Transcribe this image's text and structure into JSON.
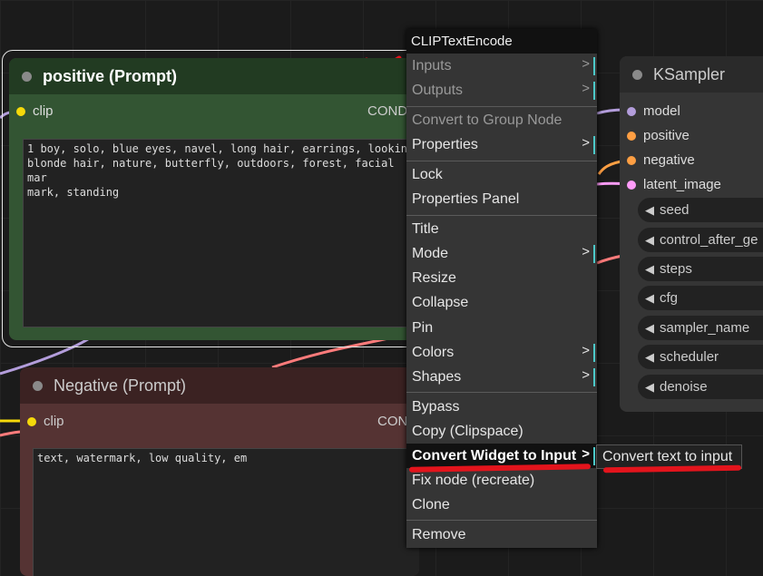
{
  "positive_node": {
    "title": "positive (Prompt)",
    "input_label": "clip",
    "output_label": "COND",
    "text": "1 boy, solo, blue eyes, navel, long hair, earrings, looking\nblonde hair, nature, butterfly, outdoors, forest, facial mar\nmark, standing"
  },
  "negative_node": {
    "title": "Negative (Prompt)",
    "input_label": "clip",
    "output_label": "CON",
    "text": "text, watermark, low quality, em"
  },
  "ksampler_node": {
    "title": "KSampler",
    "inputs": [
      "model",
      "positive",
      "negative",
      "latent_image"
    ],
    "widgets": [
      "seed",
      "control_after_ge",
      "steps",
      "cfg",
      "sampler_name",
      "scheduler",
      "denoise"
    ]
  },
  "context_menu": {
    "header": "CLIPTextEncode",
    "items": [
      {
        "label": "Inputs",
        "submenu": ">"
      },
      {
        "label": "Outputs",
        "submenu": ">"
      },
      {
        "label": "Convert to Group Node"
      },
      {
        "label": "Properties",
        "submenu": ">"
      },
      {
        "label": "Lock"
      },
      {
        "label": "Properties Panel"
      },
      {
        "label": "Title"
      },
      {
        "label": "Mode",
        "submenu": ">"
      },
      {
        "label": "Resize"
      },
      {
        "label": "Collapse"
      },
      {
        "label": "Pin"
      },
      {
        "label": "Colors",
        "submenu": ">"
      },
      {
        "label": "Shapes",
        "submenu": ">"
      },
      {
        "label": "Bypass"
      },
      {
        "label": "Copy (Clipspace)"
      },
      {
        "label": "Convert Widget to Input",
        "submenu": ">"
      },
      {
        "label": "Fix node (recreate)"
      },
      {
        "label": "Clone"
      },
      {
        "label": "Remove"
      }
    ]
  },
  "submenu": {
    "item": "Convert text to input"
  },
  "colors": {
    "annotation_red": "#e3141c",
    "accent_cyan": "#4cc9c9",
    "positive_node_bg": "#335533",
    "negative_node_bg": "#553333"
  }
}
